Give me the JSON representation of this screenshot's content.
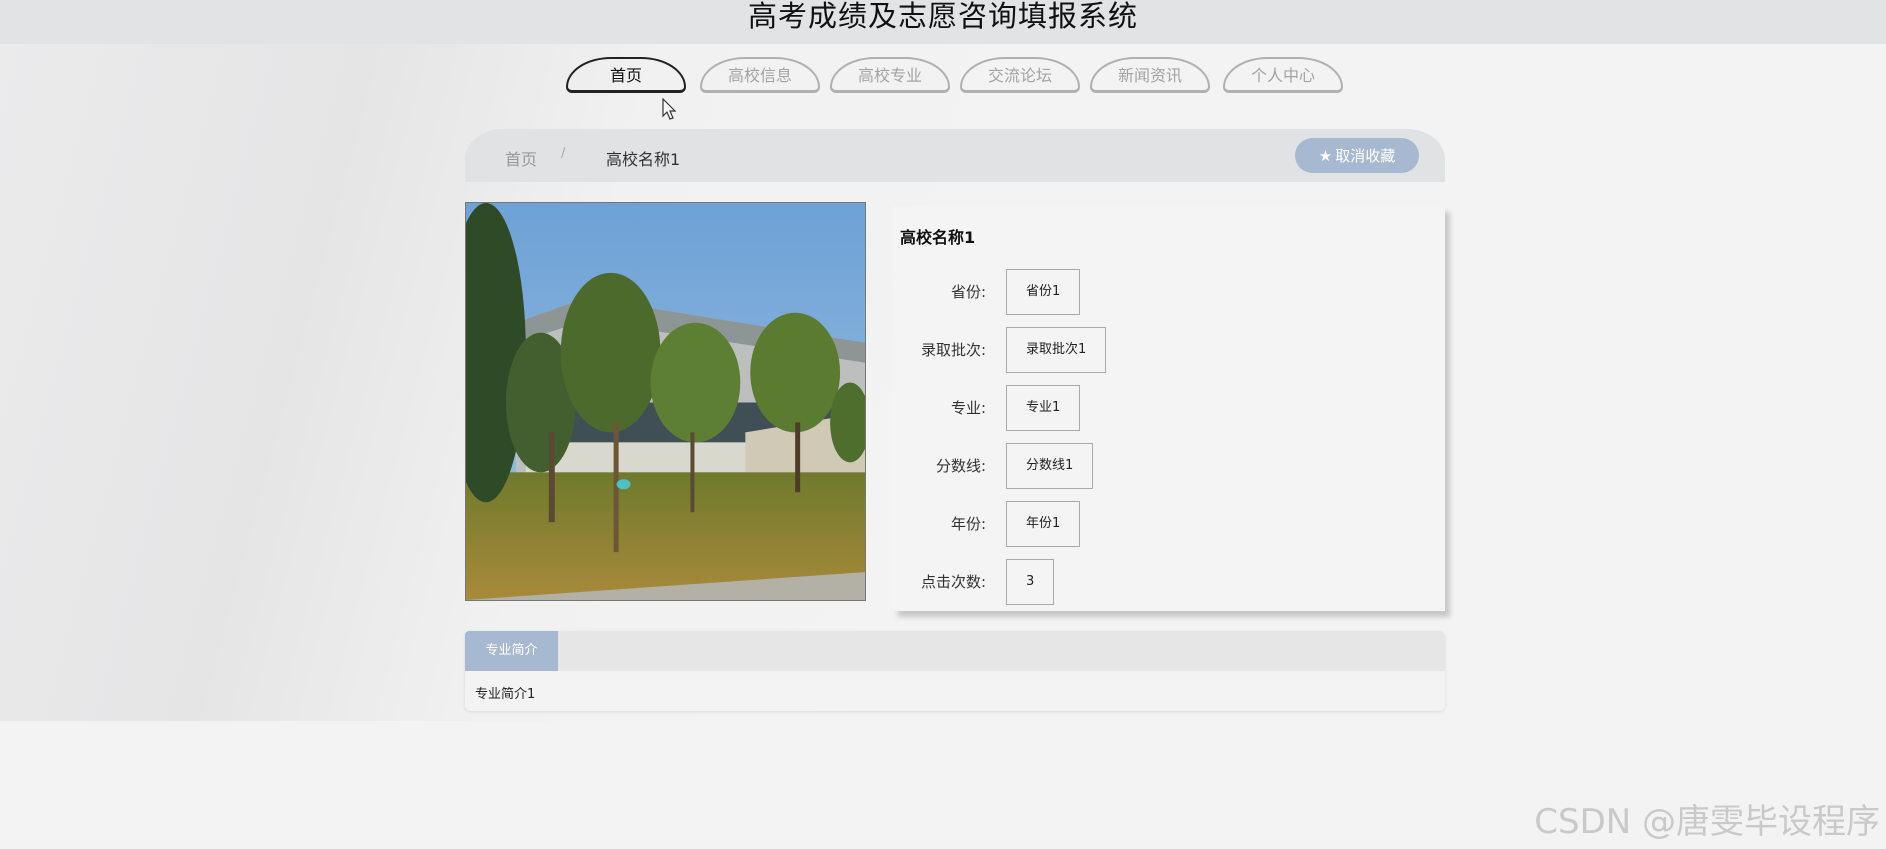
{
  "header": {
    "title": "高考成绩及志愿咨询填报系统"
  },
  "nav": {
    "tabs": [
      {
        "label": "首页",
        "active": true
      },
      {
        "label": "高校信息",
        "active": false
      },
      {
        "label": "高校专业",
        "active": false
      },
      {
        "label": "交流论坛",
        "active": false
      },
      {
        "label": "新闻资讯",
        "active": false
      },
      {
        "label": "个人中心",
        "active": false
      }
    ]
  },
  "breadcrumb": {
    "home": "首页",
    "separator": "/",
    "current": "高校名称1"
  },
  "favorite": {
    "label": "取消收藏",
    "icon": "star-icon"
  },
  "detail": {
    "name": "高校名称1",
    "fields": [
      {
        "label": "省份:",
        "value": "省份1"
      },
      {
        "label": "录取批次:",
        "value": "录取批次1"
      },
      {
        "label": "专业:",
        "value": "专业1"
      },
      {
        "label": "分数线:",
        "value": "分数线1"
      },
      {
        "label": "年份:",
        "value": "年份1"
      },
      {
        "label": "点击次数:",
        "value": "3"
      }
    ]
  },
  "tabs": {
    "active_label": "专业简介",
    "content": "专业简介1"
  },
  "watermark": "CSDN @唐雯毕设程序",
  "colors": {
    "accent": "#a7b9d0",
    "title_bar": "#e2e3e4",
    "crumb_bar": "#e1e2e3"
  }
}
